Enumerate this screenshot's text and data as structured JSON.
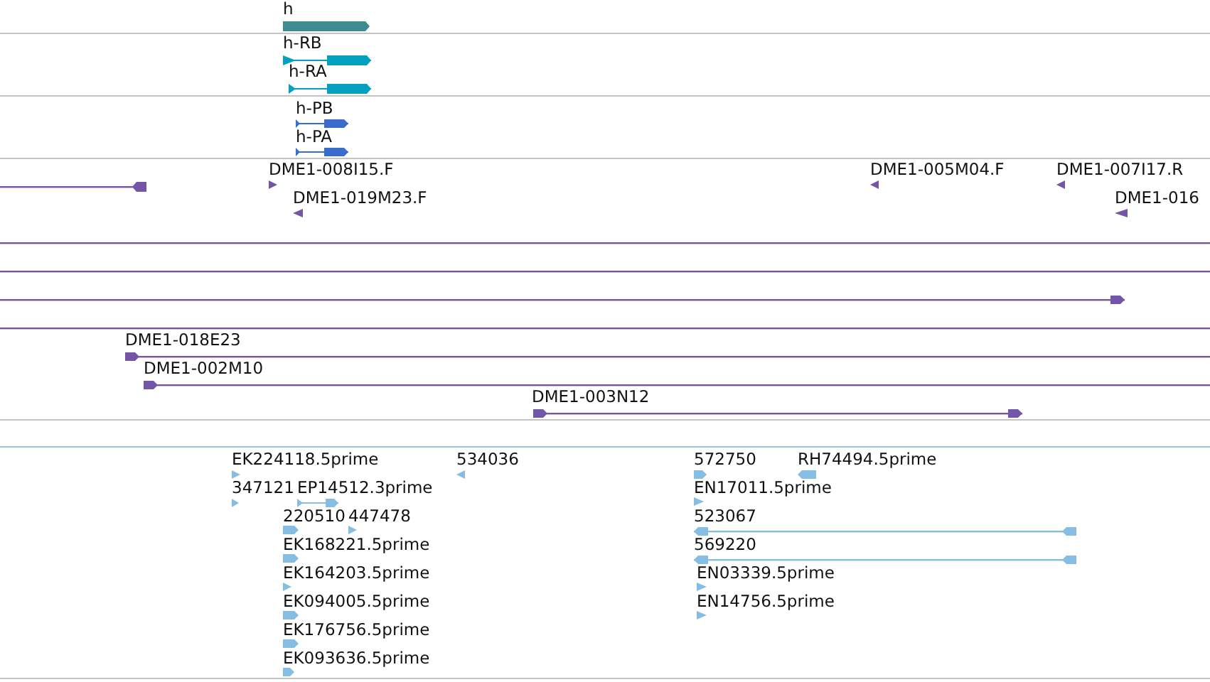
{
  "tracks": [
    {
      "kind": "gene",
      "features": [
        {
          "kind": "bar",
          "label": "h",
          "reverse": false
        }
      ]
    },
    {
      "kind": "transcript",
      "features": [
        {
          "kind": "transcript",
          "label": "h-RB",
          "reverse": false
        },
        {
          "kind": "transcript",
          "label": "h-RA",
          "reverse": false
        }
      ]
    },
    {
      "kind": "protein",
      "features": [
        {
          "kind": "transcript",
          "label": "h-PB",
          "reverse": false
        },
        {
          "kind": "transcript",
          "label": "h-PA",
          "reverse": false
        }
      ]
    },
    {
      "kind": "clone",
      "features": [
        {
          "kind": "span",
          "reverse": true
        },
        {
          "kind": "marker",
          "label": "DME1-008I15.F",
          "reverse": false
        },
        {
          "kind": "marker",
          "label": "DME1-019M23.F",
          "reverse": true
        },
        {
          "kind": "marker",
          "label": "DME1-005M04.F",
          "reverse": true
        },
        {
          "kind": "marker",
          "label": "DME1-007I17.R",
          "reverse": true
        },
        {
          "kind": "marker",
          "label": "DME1-016",
          "reverse": true
        },
        {
          "kind": "span"
        },
        {
          "kind": "span"
        },
        {
          "kind": "span",
          "reverse": false
        },
        {
          "kind": "span"
        },
        {
          "kind": "span",
          "label": "DME1-018E23",
          "reverse": false
        },
        {
          "kind": "span",
          "label": "DME1-002M10",
          "reverse": false
        },
        {
          "kind": "span",
          "label": "DME1-003N12",
          "reverse": false
        }
      ]
    },
    {
      "kind": "empty"
    },
    {
      "kind": "est",
      "features": [
        {
          "kind": "marker",
          "label": "EK224118.5prime",
          "reverse": false
        },
        {
          "kind": "marker",
          "label": "534036",
          "reverse": true
        },
        {
          "kind": "bar",
          "label": "572750",
          "reverse": false
        },
        {
          "kind": "bar",
          "label": "RH74494.5prime",
          "reverse": true
        },
        {
          "kind": "marker",
          "label": "347121",
          "reverse": false
        },
        {
          "kind": "transcript",
          "label": "EP14512.3prime",
          "reverse": false
        },
        {
          "kind": "marker",
          "label": "EN17011.5prime",
          "reverse": false
        },
        {
          "kind": "bar",
          "label": "220510",
          "reverse": false
        },
        {
          "kind": "marker",
          "label": "447478",
          "reverse": false
        },
        {
          "kind": "span",
          "label": "523067",
          "reverse": true
        },
        {
          "kind": "bar",
          "label": "EK168221.5prime",
          "reverse": false
        },
        {
          "kind": "span",
          "label": "569220",
          "reverse": true
        },
        {
          "kind": "marker",
          "label": "EK164203.5prime",
          "reverse": false
        },
        {
          "kind": "marker",
          "label": "EN03339.5prime",
          "reverse": false
        },
        {
          "kind": "bar",
          "label": "EK094005.5prime",
          "reverse": false
        },
        {
          "kind": "marker",
          "label": "EN14756.5prime",
          "reverse": false
        },
        {
          "kind": "bar",
          "label": "EK176756.5prime",
          "reverse": false
        },
        {
          "kind": "bar",
          "label": "EK093636.5prime",
          "reverse": false
        }
      ]
    }
  ]
}
